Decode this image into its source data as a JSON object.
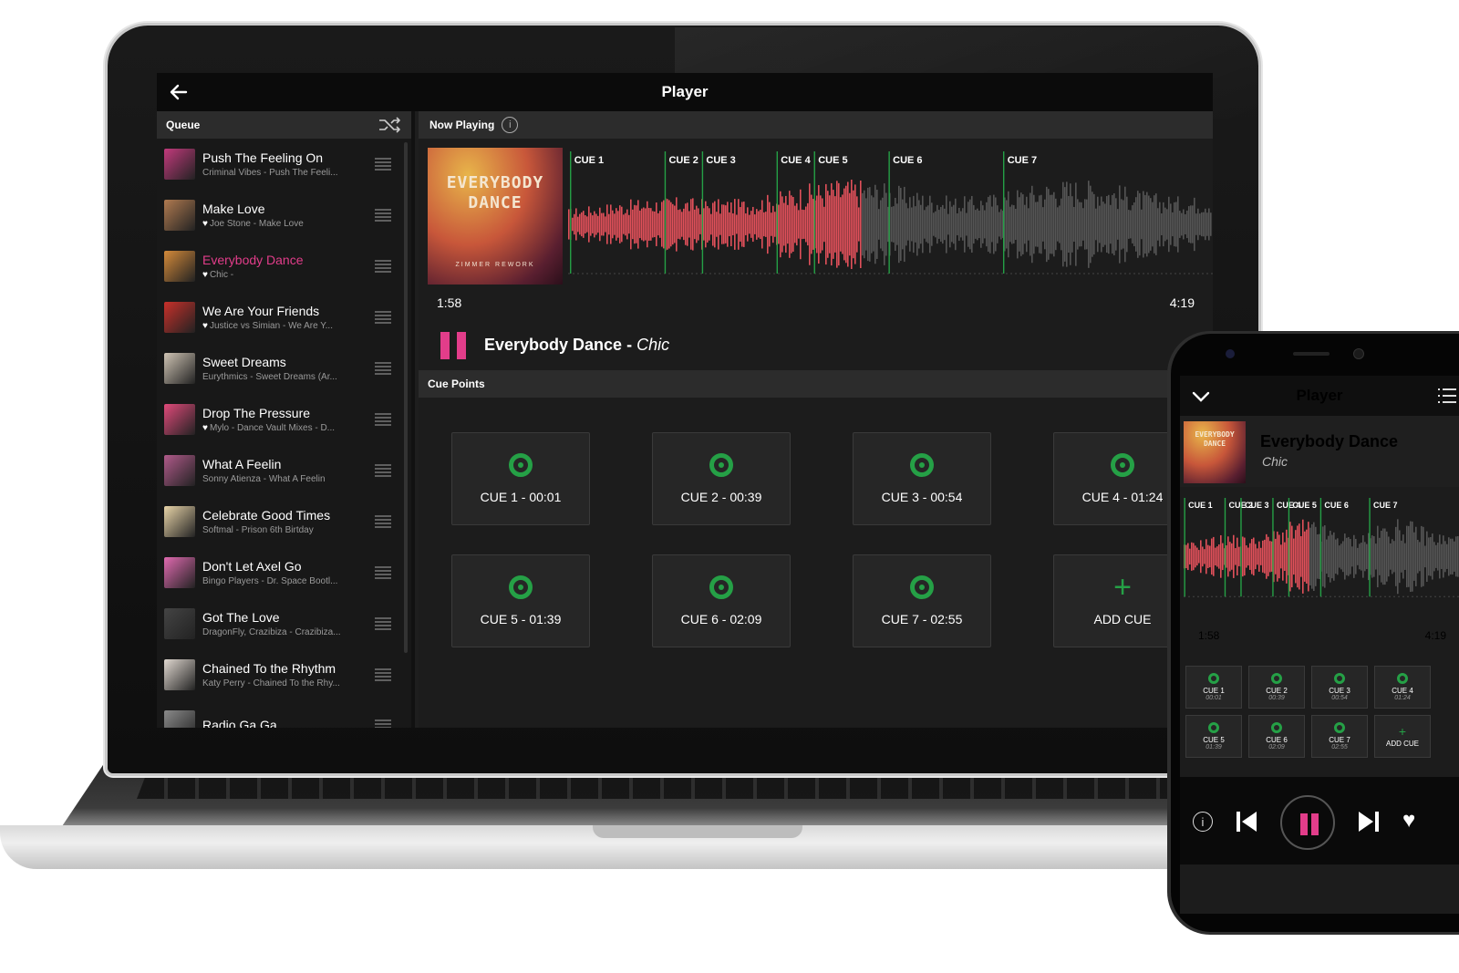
{
  "app": {
    "title": "Player"
  },
  "queue": {
    "title": "Queue",
    "items": [
      {
        "title": "Push The Feeling On",
        "subtitle": "Criminal Vibes - Push The Feeli...",
        "liked": false,
        "active": false,
        "color": "#c23a7c"
      },
      {
        "title": "Make Love",
        "subtitle": "Joe Stone - Make Love",
        "liked": true,
        "active": false,
        "color": "#b07a50"
      },
      {
        "title": "Everybody Dance",
        "subtitle": "Chic -",
        "liked": true,
        "active": true,
        "color": "#d48a3a"
      },
      {
        "title": "We Are Your Friends",
        "subtitle": "Justice vs Simian - We Are Y...",
        "liked": true,
        "active": false,
        "color": "#c8302a"
      },
      {
        "title": "Sweet Dreams",
        "subtitle": "Eurythmics - Sweet Dreams (Ar...",
        "liked": false,
        "active": false,
        "color": "#cfc4b4"
      },
      {
        "title": "Drop The Pressure",
        "subtitle": "Mylo - Dance Vault Mixes - D...",
        "liked": true,
        "active": false,
        "color": "#e04a7a"
      },
      {
        "title": "What A Feelin",
        "subtitle": "Sonny Atienza - What A Feelin",
        "liked": false,
        "active": false,
        "color": "#b05a8a"
      },
      {
        "title": "Celebrate Good Times",
        "subtitle": "Softmal - Prison 6th Birtday",
        "liked": false,
        "active": false,
        "color": "#e8d4a8"
      },
      {
        "title": "Don't Let Axel Go",
        "subtitle": "Bingo Players - Dr. Space Bootl...",
        "liked": false,
        "active": false,
        "color": "#e06ab0"
      },
      {
        "title": "Got The Love",
        "subtitle": "DragonFly, Crazibiza - Crazibiza...",
        "liked": false,
        "active": false,
        "color": "#444444"
      },
      {
        "title": "Chained To the Rhythm",
        "subtitle": "Katy Perry - Chained To the Rhy...",
        "liked": false,
        "active": false,
        "color": "#e0d8d0"
      },
      {
        "title": "Radio Ga Ga",
        "subtitle": "",
        "liked": false,
        "active": false,
        "color": "#8a8a8a"
      }
    ]
  },
  "now_playing": {
    "header": "Now Playing",
    "info_glyph": "i",
    "album_title": "EVERYBODY DANCE",
    "album_sub": "ZIMMER REWORK",
    "track": "Everybody Dance",
    "separator": " - ",
    "artist": "Chic",
    "elapsed": "1:58",
    "duration": "4:19",
    "progress": 0.456,
    "heart_glyph": "♥",
    "wave_cues": [
      "CUE 1",
      "CUE 2",
      "CUE 3",
      "CUE 4",
      "CUE 5",
      "CUE 6",
      "CUE 7"
    ],
    "cue_times_sec": [
      1,
      39,
      54,
      84,
      99,
      129,
      175
    ],
    "duration_sec": 259
  },
  "cue_points": {
    "header": "Cue Points",
    "buttons": [
      {
        "label": "CUE 1 - 00:01",
        "type": "cue"
      },
      {
        "label": "CUE 2 - 00:39",
        "type": "cue"
      },
      {
        "label": "CUE 3 - 00:54",
        "type": "cue"
      },
      {
        "label": "CUE 4 - 01:24",
        "type": "cue"
      },
      {
        "label": "CUE 5 - 01:39",
        "type": "cue"
      },
      {
        "label": "CUE 6 - 02:09",
        "type": "cue"
      },
      {
        "label": "CUE 7 - 02:55",
        "type": "cue"
      },
      {
        "label": "ADD CUE",
        "type": "add"
      }
    ],
    "plus_glyph": "+"
  },
  "phone": {
    "title": "Player",
    "track": "Everybody Dance",
    "artist": "Chic",
    "album_title": "EVERYBODY DANCE",
    "elapsed": "1:58",
    "duration": "4:19",
    "wave_cues": [
      "CUE 1",
      "CUE 2",
      "CUE 3",
      "CUE 4",
      "CUE 5",
      "CUE 6",
      "CUE 7"
    ],
    "cues": [
      {
        "label": "CUE 1",
        "time": "00:01"
      },
      {
        "label": "CUE 2",
        "time": "00:39"
      },
      {
        "label": "CUE 3",
        "time": "00:54"
      },
      {
        "label": "CUE 4",
        "time": "01:24"
      },
      {
        "label": "CUE 5",
        "time": "01:39"
      },
      {
        "label": "CUE 6",
        "time": "02:09"
      },
      {
        "label": "CUE 7",
        "time": "02:55"
      },
      {
        "label": "ADD CUE",
        "time": ""
      }
    ],
    "info_glyph": "i",
    "heart_glyph": "♥"
  },
  "colors": {
    "accent": "#e23d8a",
    "cue_green": "#25a046",
    "wave_played": "#e0505a",
    "wave_unplayed": "#555555"
  }
}
